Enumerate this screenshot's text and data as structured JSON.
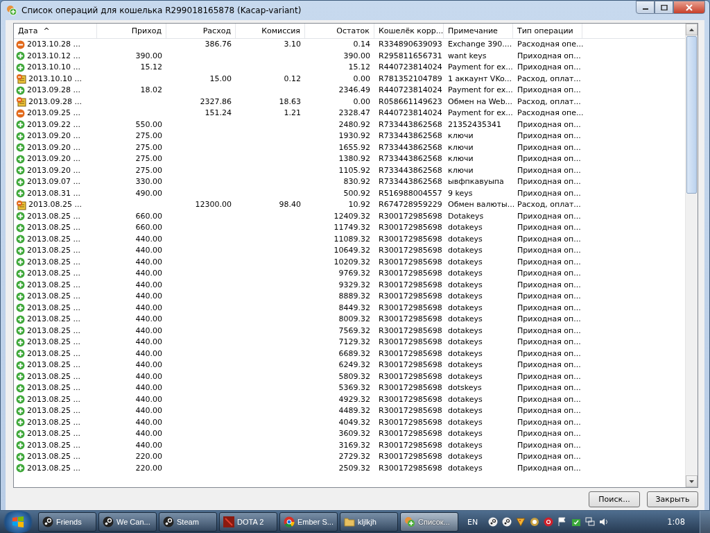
{
  "window": {
    "title": "Список операций для кошелька R299018165878 (Kacap-variant)"
  },
  "table": {
    "columns": [
      {
        "label": "Дата",
        "sort": "^"
      },
      {
        "label": "Приход"
      },
      {
        "label": "Расход"
      },
      {
        "label": "Комиссия"
      },
      {
        "label": "Остаток"
      },
      {
        "label": "Кошелёк корр..."
      },
      {
        "label": "Примечание"
      },
      {
        "label": "Тип операции"
      }
    ],
    "rows": [
      {
        "kind": "out",
        "date": "2013.10.28 ...",
        "expense": "386.76",
        "fee": "3.10",
        "balance": "0.14",
        "wallet": "R334890639093",
        "note": "Exchange 390....",
        "type": "Расходная опе..."
      },
      {
        "kind": "in",
        "date": "2013.10.12 ...",
        "income": "390.00",
        "balance": "390.00",
        "wallet": "R295811656731",
        "note": "want keys",
        "type": "Приходная оп..."
      },
      {
        "kind": "in",
        "date": "2013.10.10 ...",
        "income": "15.12",
        "balance": "15.12",
        "wallet": "R440723814024",
        "note": "Payment for ex...",
        "type": "Приходная оп..."
      },
      {
        "kind": "invoice",
        "date": "2013.10.10 ...",
        "expense": "15.00",
        "fee": "0.12",
        "balance": "0.00",
        "wallet": "R781352104789",
        "note": "1 аккаунт VKo...",
        "type": "Расход, оплат..."
      },
      {
        "kind": "in",
        "date": "2013.09.28 ...",
        "income": "18.02",
        "balance": "2346.49",
        "wallet": "R440723814024",
        "note": "Payment for ex...",
        "type": "Приходная оп..."
      },
      {
        "kind": "invoice",
        "date": "2013.09.28 ...",
        "expense": "2327.86",
        "fee": "18.63",
        "balance": "0.00",
        "wallet": "R058661149623",
        "note": "Обмен на Web...",
        "type": "Расход, оплат..."
      },
      {
        "kind": "out",
        "date": "2013.09.25 ...",
        "expense": "151.24",
        "fee": "1.21",
        "balance": "2328.47",
        "wallet": "R440723814024",
        "note": "Payment for ex...",
        "type": "Расходная опе..."
      },
      {
        "kind": "in",
        "date": "2013.09.22 ...",
        "income": "550.00",
        "balance": "2480.92",
        "wallet": "R733443862568",
        "note": "21352435341",
        "type": "Приходная оп..."
      },
      {
        "kind": "in",
        "date": "2013.09.20 ...",
        "income": "275.00",
        "balance": "1930.92",
        "wallet": "R733443862568",
        "note": "ключи",
        "type": "Приходная оп..."
      },
      {
        "kind": "in",
        "date": "2013.09.20 ...",
        "income": "275.00",
        "balance": "1655.92",
        "wallet": "R733443862568",
        "note": "ключи",
        "type": "Приходная оп..."
      },
      {
        "kind": "in",
        "date": "2013.09.20 ...",
        "income": "275.00",
        "balance": "1380.92",
        "wallet": "R733443862568",
        "note": "ключи",
        "type": "Приходная оп..."
      },
      {
        "kind": "in",
        "date": "2013.09.20 ...",
        "income": "275.00",
        "balance": "1105.92",
        "wallet": "R733443862568",
        "note": "ключи",
        "type": "Приходная оп..."
      },
      {
        "kind": "in",
        "date": "2013.09.07 ...",
        "income": "330.00",
        "balance": "830.92",
        "wallet": "R733443862568",
        "note": "ывфпкавуыпа",
        "type": "Приходная оп..."
      },
      {
        "kind": "in",
        "date": "2013.08.31 ...",
        "income": "490.00",
        "balance": "500.92",
        "wallet": "R516988004557",
        "note": "9 keys",
        "type": "Приходная оп..."
      },
      {
        "kind": "invoice",
        "date": "2013.08.25 ...",
        "expense": "12300.00",
        "fee": "98.40",
        "balance": "10.92",
        "wallet": "R674728959229",
        "note": "Обмен валюты...",
        "type": "Расход, оплат..."
      },
      {
        "kind": "in",
        "date": "2013.08.25 ...",
        "income": "660.00",
        "balance": "12409.32",
        "wallet": "R300172985698",
        "note": "Dotakeys",
        "type": "Приходная оп..."
      },
      {
        "kind": "in",
        "date": "2013.08.25 ...",
        "income": "660.00",
        "balance": "11749.32",
        "wallet": "R300172985698",
        "note": "dotakeys",
        "type": "Приходная оп..."
      },
      {
        "kind": "in",
        "date": "2013.08.25 ...",
        "income": "440.00",
        "balance": "11089.32",
        "wallet": "R300172985698",
        "note": "dotakeys",
        "type": "Приходная оп..."
      },
      {
        "kind": "in",
        "date": "2013.08.25 ...",
        "income": "440.00",
        "balance": "10649.32",
        "wallet": "R300172985698",
        "note": "dotakeys",
        "type": "Приходная оп..."
      },
      {
        "kind": "in",
        "date": "2013.08.25 ...",
        "income": "440.00",
        "balance": "10209.32",
        "wallet": "R300172985698",
        "note": "dotakeys",
        "type": "Приходная оп..."
      },
      {
        "kind": "in",
        "date": "2013.08.25 ...",
        "income": "440.00",
        "balance": "9769.32",
        "wallet": "R300172985698",
        "note": "dotakeys",
        "type": "Приходная оп..."
      },
      {
        "kind": "in",
        "date": "2013.08.25 ...",
        "income": "440.00",
        "balance": "9329.32",
        "wallet": "R300172985698",
        "note": "dotakeys",
        "type": "Приходная оп..."
      },
      {
        "kind": "in",
        "date": "2013.08.25 ...",
        "income": "440.00",
        "balance": "8889.32",
        "wallet": "R300172985698",
        "note": "dotakeys",
        "type": "Приходная оп..."
      },
      {
        "kind": "in",
        "date": "2013.08.25 ...",
        "income": "440.00",
        "balance": "8449.32",
        "wallet": "R300172985698",
        "note": "dotakeys",
        "type": "Приходная оп..."
      },
      {
        "kind": "in",
        "date": "2013.08.25 ...",
        "income": "440.00",
        "balance": "8009.32",
        "wallet": "R300172985698",
        "note": "dotakeys",
        "type": "Приходная оп..."
      },
      {
        "kind": "in",
        "date": "2013.08.25 ...",
        "income": "440.00",
        "balance": "7569.32",
        "wallet": "R300172985698",
        "note": "dotakeys",
        "type": "Приходная оп..."
      },
      {
        "kind": "in",
        "date": "2013.08.25 ...",
        "income": "440.00",
        "balance": "7129.32",
        "wallet": "R300172985698",
        "note": "dotakeys",
        "type": "Приходная оп..."
      },
      {
        "kind": "in",
        "date": "2013.08.25 ...",
        "income": "440.00",
        "balance": "6689.32",
        "wallet": "R300172985698",
        "note": "dotakeys",
        "type": "Приходная оп..."
      },
      {
        "kind": "in",
        "date": "2013.08.25 ...",
        "income": "440.00",
        "balance": "6249.32",
        "wallet": "R300172985698",
        "note": "dotakeys",
        "type": "Приходная оп..."
      },
      {
        "kind": "in",
        "date": "2013.08.25 ...",
        "income": "440.00",
        "balance": "5809.32",
        "wallet": "R300172985698",
        "note": "dotakeys",
        "type": "Приходная оп..."
      },
      {
        "kind": "in",
        "date": "2013.08.25 ...",
        "income": "440.00",
        "balance": "5369.32",
        "wallet": "R300172985698",
        "note": "dotskeys",
        "type": "Приходная оп..."
      },
      {
        "kind": "in",
        "date": "2013.08.25 ...",
        "income": "440.00",
        "balance": "4929.32",
        "wallet": "R300172985698",
        "note": "dotakeys",
        "type": "Приходная оп..."
      },
      {
        "kind": "in",
        "date": "2013.08.25 ...",
        "income": "440.00",
        "balance": "4489.32",
        "wallet": "R300172985698",
        "note": "dotakeys",
        "type": "Приходная оп..."
      },
      {
        "kind": "in",
        "date": "2013.08.25 ...",
        "income": "440.00",
        "balance": "4049.32",
        "wallet": "R300172985698",
        "note": "dotakeys",
        "type": "Приходная оп..."
      },
      {
        "kind": "in",
        "date": "2013.08.25 ...",
        "income": "440.00",
        "balance": "3609.32",
        "wallet": "R300172985698",
        "note": "dotakeys",
        "type": "Приходная оп..."
      },
      {
        "kind": "in",
        "date": "2013.08.25 ...",
        "income": "440.00",
        "balance": "3169.32",
        "wallet": "R300172985698",
        "note": "dotakeys",
        "type": "Приходная оп..."
      },
      {
        "kind": "in",
        "date": "2013.08.25 ...",
        "income": "220.00",
        "balance": "2729.32",
        "wallet": "R300172985698",
        "note": "dotakeys",
        "type": "Приходная оп..."
      },
      {
        "kind": "in",
        "date": "2013.08.25 ...",
        "income": "220.00",
        "balance": "2509.32",
        "wallet": "R300172985698",
        "note": "dotakeys",
        "type": "Приходная оп..."
      }
    ]
  },
  "buttons": [
    "Поиск...",
    "Закрыть"
  ],
  "taskbar": {
    "items": [
      {
        "label": "Friends",
        "selected": false
      },
      {
        "label": "We Can...",
        "selected": false
      },
      {
        "label": "Steam",
        "selected": false
      },
      {
        "label": "DOTA 2",
        "selected": false
      },
      {
        "label": "Ember S...",
        "selected": false
      },
      {
        "label": "kljlkjh",
        "selected": false
      },
      {
        "label": "Список...",
        "selected": true
      }
    ],
    "language": "EN",
    "clock": "1:08"
  }
}
